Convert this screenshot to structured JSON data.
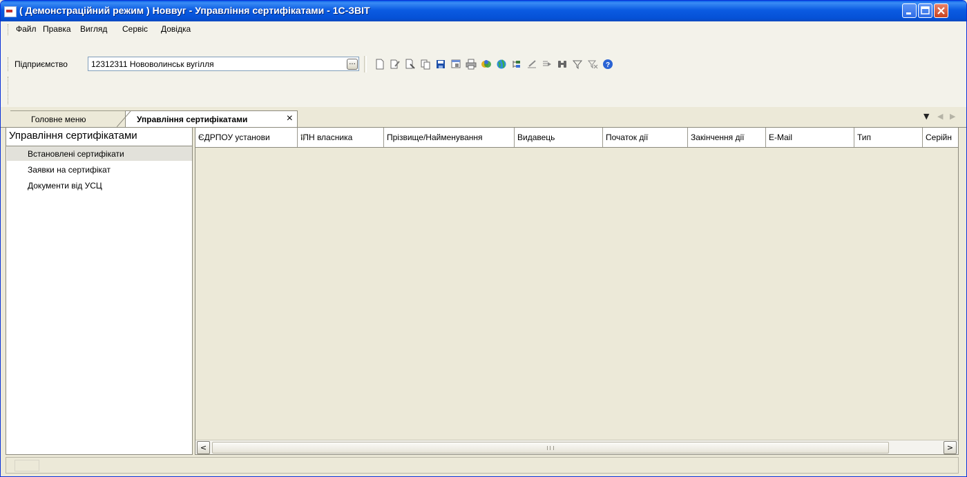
{
  "window": {
    "title": "( Демонстраційний режим ) Новвуг - Управління сертифікатами - 1С-ЗВІТ",
    "controls": [
      "minimize",
      "maximize",
      "close"
    ]
  },
  "menu": [
    "Файл",
    "Правка",
    "Вигляд",
    "Сервіс",
    "Довідка"
  ],
  "enterprise": {
    "label": "Підприємство",
    "value": "12312311  Нововолинськ вугілля",
    "browse_label": "..."
  },
  "toolbar_icons": [
    "new-doc-icon",
    "edit-doc-icon",
    "view-doc-icon",
    "copy-doc-icon",
    "save-icon",
    "properties-icon",
    "print-icon",
    "exchange-icon",
    "globe-icon",
    "tree-icon",
    "sign-icon",
    "export-icon",
    "find-icon",
    "filter-icon",
    "clear-filter-icon",
    "help-icon"
  ],
  "tabs": [
    {
      "label": "Головне меню",
      "active": false
    },
    {
      "label": "Управління сертифікатами",
      "active": true,
      "close": "×"
    }
  ],
  "tab_nav": {
    "dropdown": "▼",
    "prev": "◀",
    "next": "▶"
  },
  "left_panel": {
    "title": "Управління сертифікатами",
    "items": [
      {
        "label": "Встановлені сертифікати",
        "selected": true
      },
      {
        "label": "Заявки на сертифікат",
        "selected": false
      },
      {
        "label": "Документи від УСЦ",
        "selected": false
      }
    ]
  },
  "grid": {
    "columns": [
      "ЄДРПОУ установи",
      "ІПН власника",
      "Прізвище/Найменування",
      "Видавець",
      "Початок дії",
      "Закінчення дії",
      "E-Mail",
      "Тип",
      "Серійн"
    ],
    "rows": []
  },
  "scroll": {
    "left": "<",
    "right": ">"
  }
}
